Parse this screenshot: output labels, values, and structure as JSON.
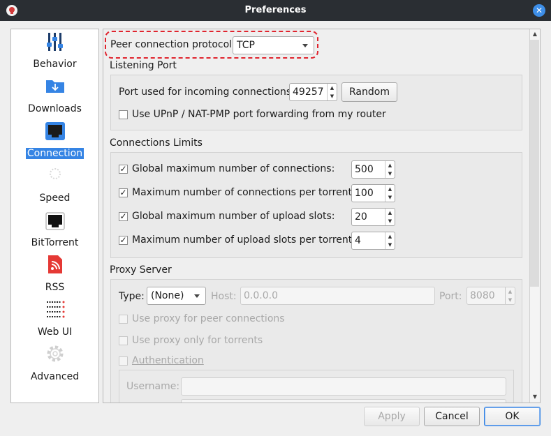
{
  "window": {
    "title": "Preferences"
  },
  "sidebar": {
    "items": [
      {
        "label": "Behavior",
        "icon": "sliders-icon",
        "selected": false
      },
      {
        "label": "Downloads",
        "icon": "download-folder-icon",
        "selected": false
      },
      {
        "label": "Connection",
        "icon": "network-port-icon",
        "selected": true
      },
      {
        "label": "Speed",
        "icon": "speedometer-icon",
        "selected": false
      },
      {
        "label": "BitTorrent",
        "icon": "network-port-black-icon",
        "selected": false
      },
      {
        "label": "RSS",
        "icon": "rss-icon",
        "selected": false
      },
      {
        "label": "Web UI",
        "icon": "web-ui-icon",
        "selected": false
      },
      {
        "label": "Advanced",
        "icon": "gear-icon",
        "selected": false
      }
    ]
  },
  "peer_protocol": {
    "label": "Peer connection protocol:",
    "value": "TCP"
  },
  "listening_port": {
    "title": "Listening Port",
    "port_label": "Port used for incoming connections:",
    "port_value": "49257",
    "random_label": "Random",
    "upnp_label": "Use UPnP / NAT-PMP port forwarding from my router",
    "upnp_checked": false
  },
  "connection_limits": {
    "title": "Connections Limits",
    "rows": [
      {
        "label": "Global maximum number of connections:",
        "value": "500",
        "checked": true
      },
      {
        "label": "Maximum number of connections per torrent:",
        "value": "100",
        "checked": true
      },
      {
        "label": "Global maximum number of upload slots:",
        "value": "20",
        "checked": true
      },
      {
        "label": "Maximum number of upload slots per torrent:",
        "value": "4",
        "checked": true
      }
    ]
  },
  "proxy": {
    "title": "Proxy Server",
    "type_label": "Type:",
    "type_value": "(None)",
    "host_label": "Host:",
    "host_value": "0.0.0.0",
    "port_label": "Port:",
    "port_value": "8080",
    "peer_conn_label": "Use proxy for peer connections",
    "torrents_only_label": "Use proxy only for torrents",
    "auth_label": "Authentication",
    "username_label": "Username:"
  },
  "buttons": {
    "apply": "Apply",
    "cancel": "Cancel",
    "ok": "OK"
  },
  "colors": {
    "accent": "#3584e4",
    "highlight": "#e0242e",
    "titlebar": "#2a2e33"
  }
}
